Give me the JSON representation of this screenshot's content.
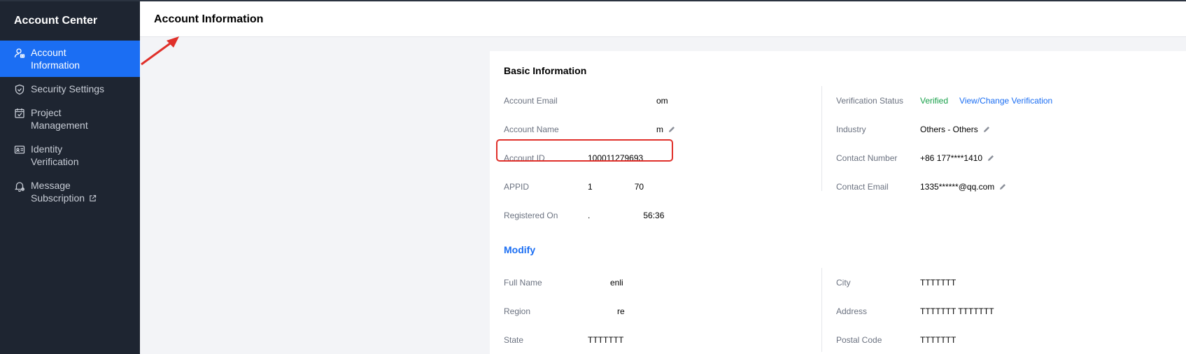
{
  "sidebar": {
    "title": "Account Center",
    "items": [
      {
        "label_line1": "Account",
        "label_line2": "Information",
        "icon": "user-info-icon"
      },
      {
        "label": "Security Settings",
        "icon": "shield-icon"
      },
      {
        "label_line1": "Project",
        "label_line2": "Management",
        "icon": "project-icon"
      },
      {
        "label_line1": "Identity",
        "label_line2": "Verification",
        "icon": "id-card-icon"
      },
      {
        "label_line1": "Message",
        "label_line2": "Subscription",
        "icon": "bell-icon",
        "external_icon": "external-link-icon"
      }
    ]
  },
  "header": {
    "title": "Account Information"
  },
  "basic": {
    "title": "Basic Information",
    "left": [
      {
        "label": "Account Email",
        "value": "om"
      },
      {
        "label": "Account Name",
        "value": "m"
      },
      {
        "label": "Account ID",
        "value": "100011279693"
      },
      {
        "label": "APPID",
        "value_prefix": "1",
        "value": "70"
      },
      {
        "label": "Registered On",
        "value_prefix": ".",
        "value": "56:36"
      }
    ],
    "right": [
      {
        "label": "Verification Status",
        "value": "Verified",
        "link": "View/Change Verification"
      },
      {
        "label": "Industry",
        "value": "Others - Others"
      },
      {
        "label": "Contact Number",
        "value": "+86 177****1410"
      },
      {
        "label": "Contact Email",
        "value": "1335******@qq.com"
      }
    ]
  },
  "modify": {
    "title": "Modify",
    "left": [
      {
        "label": "Full Name",
        "value": "enli"
      },
      {
        "label": "Region",
        "value": "re"
      },
      {
        "label": "State",
        "value": "TTTTTTT"
      }
    ],
    "right": [
      {
        "label": "City",
        "value": "TTTTTTT"
      },
      {
        "label": "Address",
        "value": "TTTTTTT TTTTTTT"
      },
      {
        "label": "Postal Code",
        "value": "TTTTTTT"
      }
    ]
  },
  "colors": {
    "accent": "#1b6ef3",
    "sidebar_bg": "#1e2531",
    "verified": "#18a04a",
    "highlight": "#e0302a"
  }
}
